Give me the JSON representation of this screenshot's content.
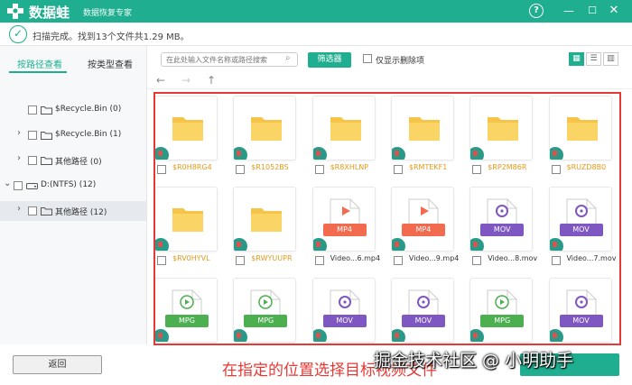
{
  "app": {
    "name": "数据蛙",
    "subtitle": "数据恢复专家"
  },
  "window_controls": {
    "help": "?",
    "minimize": "—",
    "maximize": "☐",
    "close": "✕"
  },
  "status": {
    "text": "扫描完成。找到13个文件共1.29 MB。"
  },
  "sidebar": {
    "tabs": [
      {
        "label": "按路径查看",
        "active": true
      },
      {
        "label": "按类型查看",
        "active": false
      }
    ],
    "tree": [
      {
        "label": "$Recycle.Bin (0)"
      },
      {
        "label": "$Recycle.Bin (1)"
      },
      {
        "label": "其他路径 (0)"
      },
      {
        "label": "D:(NTFS) (12)"
      },
      {
        "label": "其他路径 (12)"
      }
    ]
  },
  "toolbar": {
    "search_placeholder": "在此处输入文件名称或路径搜索",
    "filter_label": "筛选器",
    "deleted_only_label": "仅显示删除项"
  },
  "files": [
    {
      "name": "$R0H8RG4",
      "kind": "folder"
    },
    {
      "name": "$R1052BS",
      "kind": "folder"
    },
    {
      "name": "$R8XHLNP",
      "kind": "folder"
    },
    {
      "name": "$RMTEKF1",
      "kind": "folder"
    },
    {
      "name": "$RP2M86R",
      "kind": "folder"
    },
    {
      "name": "$RUZD8B0",
      "kind": "folder"
    },
    {
      "name": "$RV0HYVL",
      "kind": "folder"
    },
    {
      "name": "$RWYUUPR",
      "kind": "folder"
    },
    {
      "name": "Video...6.mp4",
      "kind": "mp4",
      "tag": "MP4"
    },
    {
      "name": "Video...9.mp4",
      "kind": "mp4",
      "tag": "MP4"
    },
    {
      "name": "Video...8.mov",
      "kind": "mov",
      "tag": "MOV"
    },
    {
      "name": "Video...7.mov",
      "kind": "mov",
      "tag": "MOV"
    },
    {
      "name": "",
      "kind": "mpg",
      "tag": "MPG"
    },
    {
      "name": "",
      "kind": "mpg",
      "tag": "MPG"
    },
    {
      "name": "",
      "kind": "mov",
      "tag": "MOV"
    },
    {
      "name": "",
      "kind": "mov",
      "tag": "MOV"
    },
    {
      "name": "",
      "kind": "mpg",
      "tag": "MPG"
    },
    {
      "name": "",
      "kind": "mov",
      "tag": "MOV"
    }
  ],
  "colors": {
    "brand": "#1fae8f",
    "mp4": "#f26b4f",
    "mov": "#7e57c2",
    "mpg": "#4caf50",
    "folder": "#f7c44a",
    "annotation": "#e53935"
  },
  "footer": {
    "back_label": "返回"
  },
  "annotation": {
    "caption": "在指定的位置选择目标视频文件"
  },
  "watermark": {
    "text": "掘金技术社区 @ 小明助手"
  }
}
